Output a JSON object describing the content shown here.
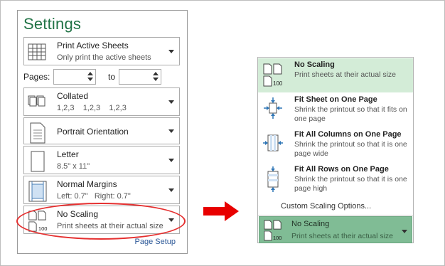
{
  "settings": {
    "title": "Settings",
    "print_what": {
      "title": "Print Active Sheets",
      "subtitle": "Only print the active sheets"
    },
    "pages": {
      "label": "Pages:",
      "from_value": "",
      "to_label": "to",
      "to_value": ""
    },
    "collation": {
      "title": "Collated",
      "subtitle": "1,2,3    1,2,3    1,2,3"
    },
    "orientation": {
      "title": "Portrait Orientation"
    },
    "paper": {
      "title": "Letter",
      "subtitle": "8.5\" x 11\""
    },
    "margins": {
      "title": "Normal Margins",
      "subtitle": "Left: 0.7\"   Right: 0.7\""
    },
    "scaling": {
      "title": "No Scaling",
      "subtitle": "Print sheets at their actual size",
      "icon_number": "100"
    },
    "page_setup_link": "Page Setup"
  },
  "scaling_menu": {
    "items": [
      {
        "title": "No Scaling",
        "desc": "Print sheets at their actual size",
        "icon": "no-scaling-icon",
        "number": "100",
        "selected": true
      },
      {
        "title": "Fit Sheet on One Page",
        "desc": "Shrink the printout so that it fits on one page",
        "icon": "fit-sheet-icon",
        "selected": false
      },
      {
        "title": "Fit All Columns on One Page",
        "desc": "Shrink the printout so that it is one page wide",
        "icon": "fit-columns-icon",
        "selected": false
      },
      {
        "title": "Fit All Rows on One Page",
        "desc": "Shrink the printout so that it is one page high",
        "icon": "fit-rows-icon",
        "selected": false
      }
    ],
    "custom_label": "Custom Scaling Options...",
    "current": {
      "title": "No Scaling",
      "subtitle": "Print sheets at their actual size",
      "number": "100"
    }
  },
  "colors": {
    "accent": "#217346",
    "highlight": "#e53030",
    "menu_selected": "#d3ecd7",
    "current_bg": "#80bc95"
  }
}
